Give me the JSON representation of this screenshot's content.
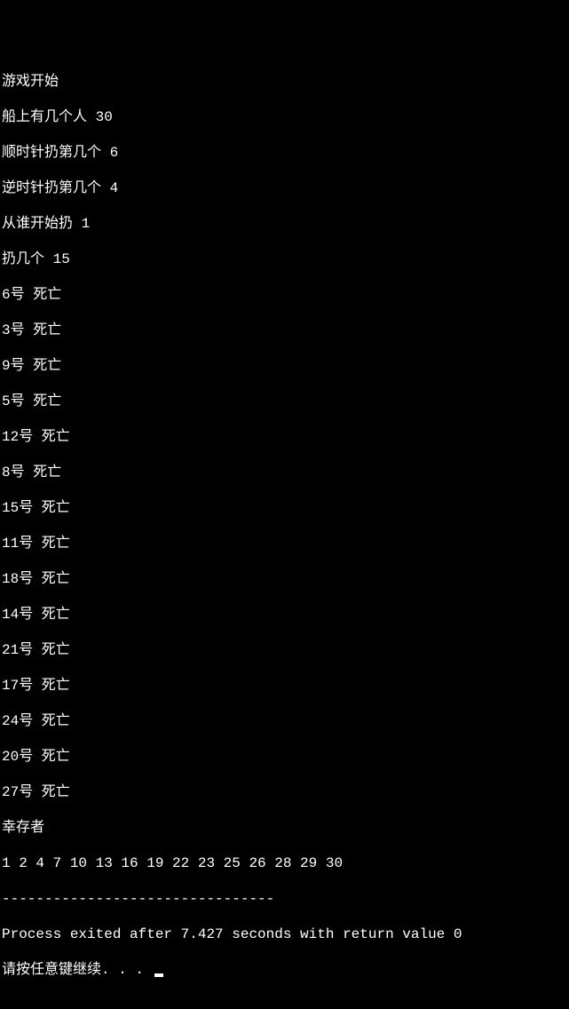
{
  "lines": {
    "game_start": "游戏开始",
    "prompt_people": "船上有几个人 30",
    "prompt_cw": "顺时针扔第几个 6",
    "prompt_ccw": "逆时针扔第几个 4",
    "prompt_start": "从谁开始扔 1",
    "prompt_count": "扔几个 15"
  },
  "deaths": [
    "6号 死亡",
    "3号 死亡",
    "9号 死亡",
    "5号 死亡",
    "12号 死亡",
    "8号 死亡",
    "15号 死亡",
    "11号 死亡",
    "18号 死亡",
    "14号 死亡",
    "21号 死亡",
    "17号 死亡",
    "24号 死亡",
    "20号 死亡",
    "27号 死亡"
  ],
  "survivors_label": "幸存者",
  "survivors": "1 2 4 7 10 13 16 19 22 23 25 26 28 29 30",
  "divider": "--------------------------------",
  "process_exit": "Process exited after 7.427 seconds with return value 0",
  "press_key": "请按任意键继续. . . "
}
